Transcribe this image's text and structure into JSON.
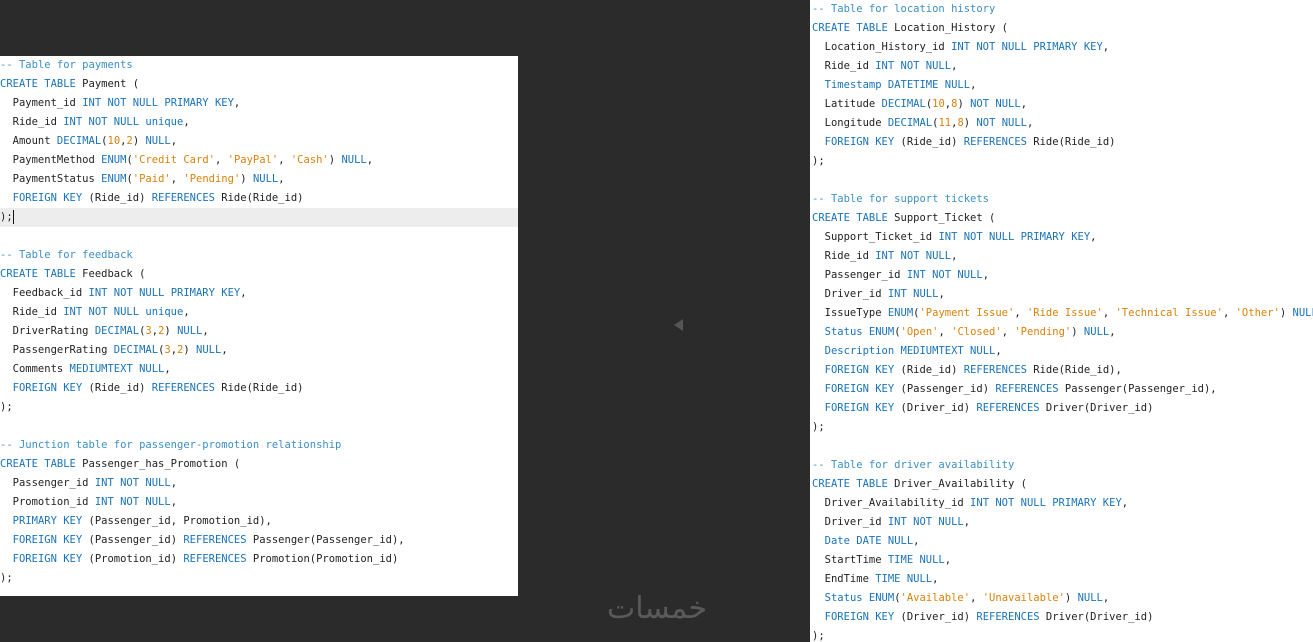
{
  "colors": {
    "background": "#2b2b2b",
    "panel": "#ffffff",
    "keyword": "#1a73b8",
    "comment": "#3d8fc4",
    "string": "#d9820b",
    "number": "#d9820b",
    "plain": "#1f1f1f",
    "active_line": "#ededed"
  },
  "left_panel": {
    "lines": [
      [
        {
          "t": "cm",
          "v": "-- Table for payments"
        }
      ],
      [
        {
          "t": "kw",
          "v": "CREATE TABLE"
        },
        {
          "t": "pl",
          "v": " Payment ("
        }
      ],
      [
        {
          "t": "pl",
          "v": "  Payment_id "
        },
        {
          "t": "kw",
          "v": "INT NOT NULL PRIMARY KEY"
        },
        {
          "t": "pl",
          "v": ","
        }
      ],
      [
        {
          "t": "pl",
          "v": "  Ride_id "
        },
        {
          "t": "kw",
          "v": "INT NOT NULL unique"
        },
        {
          "t": "pl",
          "v": ","
        }
      ],
      [
        {
          "t": "pl",
          "v": "  Amount "
        },
        {
          "t": "kw",
          "v": "DECIMAL"
        },
        {
          "t": "pl",
          "v": "("
        },
        {
          "t": "num",
          "v": "10"
        },
        {
          "t": "pl",
          "v": ","
        },
        {
          "t": "num",
          "v": "2"
        },
        {
          "t": "pl",
          "v": ") "
        },
        {
          "t": "kw",
          "v": "NULL"
        },
        {
          "t": "pl",
          "v": ","
        }
      ],
      [
        {
          "t": "pl",
          "v": "  PaymentMethod "
        },
        {
          "t": "kw",
          "v": "ENUM"
        },
        {
          "t": "pl",
          "v": "("
        },
        {
          "t": "str",
          "v": "'Credit Card'"
        },
        {
          "t": "pl",
          "v": ", "
        },
        {
          "t": "str",
          "v": "'PayPal'"
        },
        {
          "t": "pl",
          "v": ", "
        },
        {
          "t": "str",
          "v": "'Cash'"
        },
        {
          "t": "pl",
          "v": ") "
        },
        {
          "t": "kw",
          "v": "NULL"
        },
        {
          "t": "pl",
          "v": ","
        }
      ],
      [
        {
          "t": "pl",
          "v": "  PaymentStatus "
        },
        {
          "t": "kw",
          "v": "ENUM"
        },
        {
          "t": "pl",
          "v": "("
        },
        {
          "t": "str",
          "v": "'Paid'"
        },
        {
          "t": "pl",
          "v": ", "
        },
        {
          "t": "str",
          "v": "'Pending'"
        },
        {
          "t": "pl",
          "v": ") "
        },
        {
          "t": "kw",
          "v": "NULL"
        },
        {
          "t": "pl",
          "v": ","
        }
      ],
      [
        {
          "t": "pl",
          "v": "  "
        },
        {
          "t": "kw",
          "v": "FOREIGN KEY"
        },
        {
          "t": "pl",
          "v": " (Ride_id) "
        },
        {
          "t": "kw",
          "v": "REFERENCES"
        },
        {
          "t": "pl",
          "v": " Ride(Ride_id)"
        }
      ],
      [
        {
          "t": "pl",
          "v": ");"
        }
      ],
      [],
      [
        {
          "t": "cm",
          "v": "-- Table for feedback"
        }
      ],
      [
        {
          "t": "kw",
          "v": "CREATE TABLE"
        },
        {
          "t": "pl",
          "v": " Feedback ("
        }
      ],
      [
        {
          "t": "pl",
          "v": "  Feedback_id "
        },
        {
          "t": "kw",
          "v": "INT NOT NULL PRIMARY KEY"
        },
        {
          "t": "pl",
          "v": ","
        }
      ],
      [
        {
          "t": "pl",
          "v": "  Ride_id "
        },
        {
          "t": "kw",
          "v": "INT NOT NULL unique"
        },
        {
          "t": "pl",
          "v": ","
        }
      ],
      [
        {
          "t": "pl",
          "v": "  DriverRating "
        },
        {
          "t": "kw",
          "v": "DECIMAL"
        },
        {
          "t": "pl",
          "v": "("
        },
        {
          "t": "num",
          "v": "3"
        },
        {
          "t": "pl",
          "v": ","
        },
        {
          "t": "num",
          "v": "2"
        },
        {
          "t": "pl",
          "v": ") "
        },
        {
          "t": "kw",
          "v": "NULL"
        },
        {
          "t": "pl",
          "v": ","
        }
      ],
      [
        {
          "t": "pl",
          "v": "  PassengerRating "
        },
        {
          "t": "kw",
          "v": "DECIMAL"
        },
        {
          "t": "pl",
          "v": "("
        },
        {
          "t": "num",
          "v": "3"
        },
        {
          "t": "pl",
          "v": ","
        },
        {
          "t": "num",
          "v": "2"
        },
        {
          "t": "pl",
          "v": ") "
        },
        {
          "t": "kw",
          "v": "NULL"
        },
        {
          "t": "pl",
          "v": ","
        }
      ],
      [
        {
          "t": "pl",
          "v": "  Comments "
        },
        {
          "t": "kw",
          "v": "MEDIUMTEXT NULL"
        },
        {
          "t": "pl",
          "v": ","
        }
      ],
      [
        {
          "t": "pl",
          "v": "  "
        },
        {
          "t": "kw",
          "v": "FOREIGN KEY"
        },
        {
          "t": "pl",
          "v": " (Ride_id) "
        },
        {
          "t": "kw",
          "v": "REFERENCES"
        },
        {
          "t": "pl",
          "v": " Ride(Ride_id)"
        }
      ],
      [
        {
          "t": "pl",
          "v": ");"
        }
      ],
      [],
      [
        {
          "t": "cm",
          "v": "-- Junction table for passenger-promotion relationship"
        }
      ],
      [
        {
          "t": "kw",
          "v": "CREATE TABLE"
        },
        {
          "t": "pl",
          "v": " Passenger_has_Promotion ("
        }
      ],
      [
        {
          "t": "pl",
          "v": "  Passenger_id "
        },
        {
          "t": "kw",
          "v": "INT NOT NULL"
        },
        {
          "t": "pl",
          "v": ","
        }
      ],
      [
        {
          "t": "pl",
          "v": "  Promotion_id "
        },
        {
          "t": "kw",
          "v": "INT NOT NULL"
        },
        {
          "t": "pl",
          "v": ","
        }
      ],
      [
        {
          "t": "pl",
          "v": "  "
        },
        {
          "t": "kw",
          "v": "PRIMARY KEY"
        },
        {
          "t": "pl",
          "v": " (Passenger_id, Promotion_id),"
        }
      ],
      [
        {
          "t": "pl",
          "v": "  "
        },
        {
          "t": "kw",
          "v": "FOREIGN KEY"
        },
        {
          "t": "pl",
          "v": " (Passenger_id) "
        },
        {
          "t": "kw",
          "v": "REFERENCES"
        },
        {
          "t": "pl",
          "v": " Passenger(Passenger_id),"
        }
      ],
      [
        {
          "t": "pl",
          "v": "  "
        },
        {
          "t": "kw",
          "v": "FOREIGN KEY"
        },
        {
          "t": "pl",
          "v": " (Promotion_id) "
        },
        {
          "t": "kw",
          "v": "REFERENCES"
        },
        {
          "t": "pl",
          "v": " Promotion(Promotion_id)"
        }
      ],
      [
        {
          "t": "pl",
          "v": ");"
        }
      ]
    ],
    "active_line_index": 8
  },
  "right_panel": {
    "lines": [
      [
        {
          "t": "cm",
          "v": "-- Table for location history"
        }
      ],
      [
        {
          "t": "kw",
          "v": "CREATE TABLE"
        },
        {
          "t": "pl",
          "v": " Location_History ("
        }
      ],
      [
        {
          "t": "pl",
          "v": "  Location_History_id "
        },
        {
          "t": "kw",
          "v": "INT NOT NULL PRIMARY KEY"
        },
        {
          "t": "pl",
          "v": ","
        }
      ],
      [
        {
          "t": "pl",
          "v": "  Ride_id "
        },
        {
          "t": "kw",
          "v": "INT NOT NULL"
        },
        {
          "t": "pl",
          "v": ","
        }
      ],
      [
        {
          "t": "pl",
          "v": "  "
        },
        {
          "t": "kw",
          "v": "Timestamp DATETIME NULL"
        },
        {
          "t": "pl",
          "v": ","
        }
      ],
      [
        {
          "t": "pl",
          "v": "  Latitude "
        },
        {
          "t": "kw",
          "v": "DECIMAL"
        },
        {
          "t": "pl",
          "v": "("
        },
        {
          "t": "num",
          "v": "10"
        },
        {
          "t": "pl",
          "v": ","
        },
        {
          "t": "num",
          "v": "8"
        },
        {
          "t": "pl",
          "v": ") "
        },
        {
          "t": "kw",
          "v": "NOT NULL"
        },
        {
          "t": "pl",
          "v": ","
        }
      ],
      [
        {
          "t": "pl",
          "v": "  Longitude "
        },
        {
          "t": "kw",
          "v": "DECIMAL"
        },
        {
          "t": "pl",
          "v": "("
        },
        {
          "t": "num",
          "v": "11"
        },
        {
          "t": "pl",
          "v": ","
        },
        {
          "t": "num",
          "v": "8"
        },
        {
          "t": "pl",
          "v": ") "
        },
        {
          "t": "kw",
          "v": "NOT NULL"
        },
        {
          "t": "pl",
          "v": ","
        }
      ],
      [
        {
          "t": "pl",
          "v": "  "
        },
        {
          "t": "kw",
          "v": "FOREIGN KEY"
        },
        {
          "t": "pl",
          "v": " (Ride_id) "
        },
        {
          "t": "kw",
          "v": "REFERENCES"
        },
        {
          "t": "pl",
          "v": " Ride(Ride_id)"
        }
      ],
      [
        {
          "t": "pl",
          "v": ");"
        }
      ],
      [],
      [
        {
          "t": "cm",
          "v": "-- Table for support tickets"
        }
      ],
      [
        {
          "t": "kw",
          "v": "CREATE TABLE"
        },
        {
          "t": "pl",
          "v": " Support_Ticket ("
        }
      ],
      [
        {
          "t": "pl",
          "v": "  Support_Ticket_id "
        },
        {
          "t": "kw",
          "v": "INT NOT NULL PRIMARY KEY"
        },
        {
          "t": "pl",
          "v": ","
        }
      ],
      [
        {
          "t": "pl",
          "v": "  Ride_id "
        },
        {
          "t": "kw",
          "v": "INT NOT NULL"
        },
        {
          "t": "pl",
          "v": ","
        }
      ],
      [
        {
          "t": "pl",
          "v": "  Passenger_id "
        },
        {
          "t": "kw",
          "v": "INT NOT NULL"
        },
        {
          "t": "pl",
          "v": ","
        }
      ],
      [
        {
          "t": "pl",
          "v": "  Driver_id "
        },
        {
          "t": "kw",
          "v": "INT NULL"
        },
        {
          "t": "pl",
          "v": ","
        }
      ],
      [
        {
          "t": "pl",
          "v": "  IssueType "
        },
        {
          "t": "kw",
          "v": "ENUM"
        },
        {
          "t": "pl",
          "v": "("
        },
        {
          "t": "str",
          "v": "'Payment Issue'"
        },
        {
          "t": "pl",
          "v": ", "
        },
        {
          "t": "str",
          "v": "'Ride Issue'"
        },
        {
          "t": "pl",
          "v": ", "
        },
        {
          "t": "str",
          "v": "'Technical Issue'"
        },
        {
          "t": "pl",
          "v": ", "
        },
        {
          "t": "str",
          "v": "'Other'"
        },
        {
          "t": "pl",
          "v": ") "
        },
        {
          "t": "kw",
          "v": "NULL"
        },
        {
          "t": "pl",
          "v": ","
        }
      ],
      [
        {
          "t": "pl",
          "v": "  "
        },
        {
          "t": "kw",
          "v": "Status ENUM"
        },
        {
          "t": "pl",
          "v": "("
        },
        {
          "t": "str",
          "v": "'Open'"
        },
        {
          "t": "pl",
          "v": ", "
        },
        {
          "t": "str",
          "v": "'Closed'"
        },
        {
          "t": "pl",
          "v": ", "
        },
        {
          "t": "str",
          "v": "'Pending'"
        },
        {
          "t": "pl",
          "v": ") "
        },
        {
          "t": "kw",
          "v": "NULL"
        },
        {
          "t": "pl",
          "v": ","
        }
      ],
      [
        {
          "t": "pl",
          "v": "  "
        },
        {
          "t": "kw",
          "v": "Description MEDIUMTEXT NULL"
        },
        {
          "t": "pl",
          "v": ","
        }
      ],
      [
        {
          "t": "pl",
          "v": "  "
        },
        {
          "t": "kw",
          "v": "FOREIGN KEY"
        },
        {
          "t": "pl",
          "v": " (Ride_id) "
        },
        {
          "t": "kw",
          "v": "REFERENCES"
        },
        {
          "t": "pl",
          "v": " Ride(Ride_id),"
        }
      ],
      [
        {
          "t": "pl",
          "v": "  "
        },
        {
          "t": "kw",
          "v": "FOREIGN KEY"
        },
        {
          "t": "pl",
          "v": " (Passenger_id) "
        },
        {
          "t": "kw",
          "v": "REFERENCES"
        },
        {
          "t": "pl",
          "v": " Passenger(Passenger_id),"
        }
      ],
      [
        {
          "t": "pl",
          "v": "  "
        },
        {
          "t": "kw",
          "v": "FOREIGN KEY"
        },
        {
          "t": "pl",
          "v": " (Driver_id) "
        },
        {
          "t": "kw",
          "v": "REFERENCES"
        },
        {
          "t": "pl",
          "v": " Driver(Driver_id)"
        }
      ],
      [
        {
          "t": "pl",
          "v": ");"
        }
      ],
      [],
      [
        {
          "t": "cm",
          "v": "-- Table for driver availability"
        }
      ],
      [
        {
          "t": "kw",
          "v": "CREATE TABLE"
        },
        {
          "t": "pl",
          "v": " Driver_Availability ("
        }
      ],
      [
        {
          "t": "pl",
          "v": "  Driver_Availability_id "
        },
        {
          "t": "kw",
          "v": "INT NOT NULL PRIMARY KEY"
        },
        {
          "t": "pl",
          "v": ","
        }
      ],
      [
        {
          "t": "pl",
          "v": "  Driver_id "
        },
        {
          "t": "kw",
          "v": "INT NOT NULL"
        },
        {
          "t": "pl",
          "v": ","
        }
      ],
      [
        {
          "t": "pl",
          "v": "  "
        },
        {
          "t": "kw",
          "v": "Date DATE NULL"
        },
        {
          "t": "pl",
          "v": ","
        }
      ],
      [
        {
          "t": "pl",
          "v": "  StartTime "
        },
        {
          "t": "kw",
          "v": "TIME NULL"
        },
        {
          "t": "pl",
          "v": ","
        }
      ],
      [
        {
          "t": "pl",
          "v": "  EndTime "
        },
        {
          "t": "kw",
          "v": "TIME NULL"
        },
        {
          "t": "pl",
          "v": ","
        }
      ],
      [
        {
          "t": "pl",
          "v": "  "
        },
        {
          "t": "kw",
          "v": "Status ENUM"
        },
        {
          "t": "pl",
          "v": "("
        },
        {
          "t": "str",
          "v": "'Available'"
        },
        {
          "t": "pl",
          "v": ", "
        },
        {
          "t": "str",
          "v": "'Unavailable'"
        },
        {
          "t": "pl",
          "v": ") "
        },
        {
          "t": "kw",
          "v": "NULL"
        },
        {
          "t": "pl",
          "v": ","
        }
      ],
      [
        {
          "t": "pl",
          "v": "  "
        },
        {
          "t": "kw",
          "v": "FOREIGN KEY"
        },
        {
          "t": "pl",
          "v": " (Driver_id) "
        },
        {
          "t": "kw",
          "v": "REFERENCES"
        },
        {
          "t": "pl",
          "v": " Driver(Driver_id)"
        }
      ],
      [
        {
          "t": "pl",
          "v": ");"
        }
      ]
    ]
  },
  "watermark": {
    "text": "خمسات"
  }
}
